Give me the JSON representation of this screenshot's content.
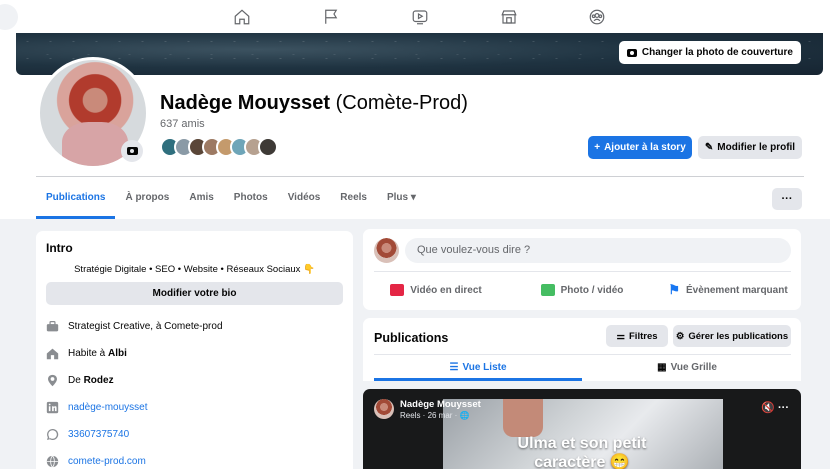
{
  "nav": {
    "icons": [
      "home-icon",
      "flag-icon",
      "video-icon",
      "marketplace-icon",
      "groups-icon"
    ]
  },
  "cover": {
    "change_label": "Changer la photo de couverture"
  },
  "profile": {
    "name": "Nadège Mouysset",
    "alt_name": "(Comète-Prod)",
    "friends": "637 amis",
    "add_story": "Ajouter à la story",
    "edit_profile": "Modifier le profil"
  },
  "tabs": [
    "Publications",
    "À propos",
    "Amis",
    "Photos",
    "Vidéos",
    "Reels",
    "Plus ▾"
  ],
  "more": "···",
  "intro": {
    "title": "Intro",
    "bio": "Stratégie Digitale • SEO • Website • Réseaux Sociaux",
    "edit_bio": "Modifier votre bio",
    "rows": {
      "work": "Strategist Creative, à Comete-prod",
      "lives_prefix": "Habite à ",
      "lives_city": "Albi",
      "from_prefix": "De ",
      "from_city": "Rodez",
      "linkedin": "nadège-mouysset",
      "whatsapp": "33607375740",
      "website": "comete-prod.com"
    }
  },
  "composer": {
    "placeholder": "Que voulez-vous dire ?",
    "live": "Vidéo en direct",
    "photo": "Photo / vidéo",
    "event": "Évènement marquant"
  },
  "publications": {
    "title": "Publications",
    "filters": "Filtres",
    "manage": "Gérer les publications",
    "list_view": "Vue Liste",
    "grid_view": "Vue Grille"
  },
  "reel": {
    "author": "Nadège Mouysset",
    "meta": "Reels · 26 mar · 🌐",
    "caption_line1": "Ulma et son petit",
    "caption_line2": "caractère 😁",
    "controls": "🔇 ···"
  },
  "colors": {
    "accent": "#1b74e4",
    "background": "#f0f2f5"
  }
}
